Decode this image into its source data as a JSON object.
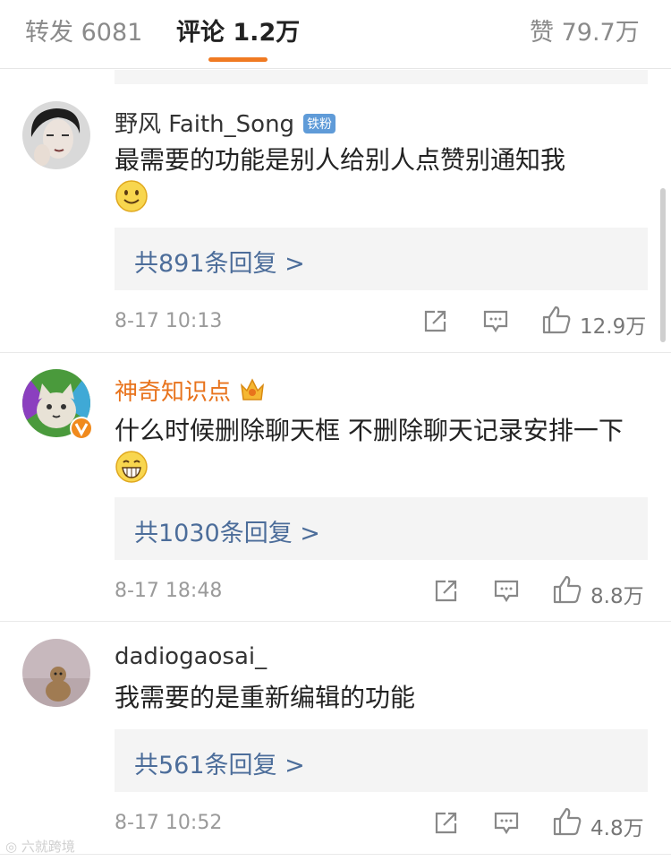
{
  "tabs": {
    "repost": "转发 6081",
    "comments": "评论 1.2万",
    "likes": "赞 79.7万"
  },
  "comments": [
    {
      "username": "野风 Faith_Song",
      "badge": "铁粉",
      "text": "最需要的功能是别人给别人点赞别通知我",
      "emoji": "smile-emoji",
      "replies": "共891条回复 >",
      "time": "8-17 10:13",
      "likes": "12.9万"
    },
    {
      "username": "神奇知识点",
      "text": "什么时候删除聊天框 不删除聊天记录安排一下",
      "emoji": "grin-emoji",
      "replies": "共1030条回复 >",
      "time": "8-17 18:48",
      "likes": "8.8万"
    },
    {
      "username": "dadiogaosai_",
      "text": "我需要的是重新编辑的功能",
      "replies": "共561条回复 >",
      "time": "8-17 10:52",
      "likes": "4.8万"
    }
  ],
  "watermark": "六就跨境",
  "colors": {
    "accent": "#f07a22",
    "link": "#4c6d9a",
    "vip_name": "#e8731c",
    "fan_badge": "#5f9bd8"
  }
}
